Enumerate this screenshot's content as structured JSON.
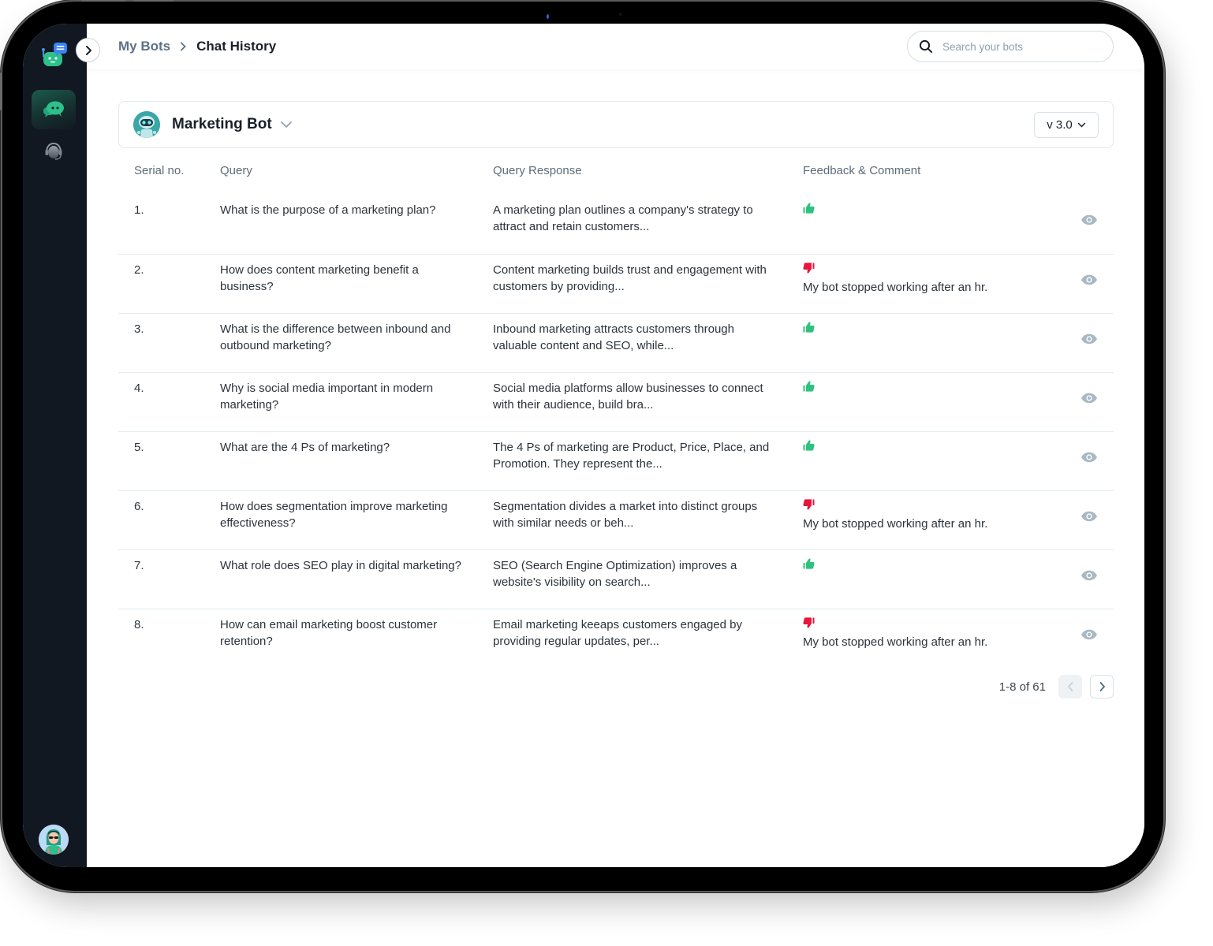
{
  "app": {
    "breadcrumb": {
      "parent": "My Bots",
      "current": "Chat History"
    },
    "search": {
      "placeholder": "Search your bots",
      "value": ""
    }
  },
  "sidebar": {
    "items": [
      {
        "name": "chat-history",
        "icon": "chat-bubbles-icon",
        "active": true
      },
      {
        "name": "support",
        "icon": "headset-icon",
        "active": false
      }
    ]
  },
  "bot": {
    "name": "Marketing Bot",
    "version": "v 3.0"
  },
  "table": {
    "headers": [
      "Serial no.",
      "Query",
      "Query Response",
      "Feedback & Comment"
    ],
    "rows": [
      {
        "serial": "1.",
        "query": "What is the purpose of a marketing plan?",
        "response": "A marketing plan outlines a company's strategy to attract and retain customers...",
        "feedback": "thumbs-up",
        "comment": ""
      },
      {
        "serial": "2.",
        "query": "How does content marketing benefit a business?",
        "response": "Content marketing builds trust and engagement with customers by providing...",
        "feedback": "thumbs-down",
        "comment": "My bot stopped working after an hr."
      },
      {
        "serial": "3.",
        "query": "What is the difference between inbound and outbound marketing?",
        "response": "Inbound marketing attracts customers through valuable content and SEO, while...",
        "feedback": "thumbs-up",
        "comment": ""
      },
      {
        "serial": "4.",
        "query": "Why is social media important in modern marketing?",
        "response": "Social media platforms allow businesses to connect with their audience, build bra...",
        "feedback": "thumbs-up",
        "comment": ""
      },
      {
        "serial": "5.",
        "query": "What are the 4 Ps of marketing?",
        "response": "The 4 Ps of marketing are Product, Price, Place, and Promotion. They represent the...",
        "feedback": "thumbs-up",
        "comment": ""
      },
      {
        "serial": "6.",
        "query": "How does segmentation improve marketing effectiveness?",
        "response": "Segmentation divides a market into distinct groups with similar needs or beh...",
        "feedback": "thumbs-down",
        "comment": "My bot stopped working after an hr."
      },
      {
        "serial": "7.",
        "query": "What role does SEO play in digital marketing?",
        "response": "SEO (Search Engine Optimization) improves a website's visibility on search...",
        "feedback": "thumbs-up",
        "comment": ""
      },
      {
        "serial": "8.",
        "query": "How can email marketing boost customer retention?",
        "response": "Email marketing keeaps customers engaged by providing regular updates, per...",
        "feedback": "thumbs-down",
        "comment": "My bot stopped working after an hr."
      }
    ]
  },
  "pagination": {
    "label": "1-8 of 61",
    "prev_disabled": true,
    "next_disabled": false
  },
  "colors": {
    "positive": "#2ec27e",
    "negative": "#e8163c",
    "sidebar_bg": "#121821",
    "accent": "#2ec08a"
  }
}
